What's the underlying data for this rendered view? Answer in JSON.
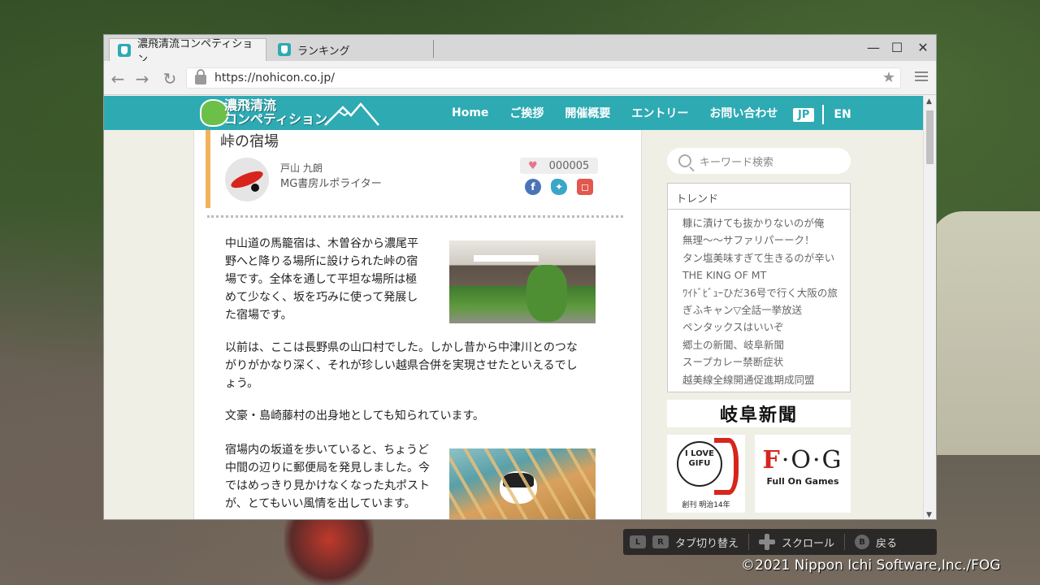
{
  "browser": {
    "tabs": [
      {
        "label": "濃飛清流コンペティション",
        "active": true
      },
      {
        "label": "ランキング",
        "active": false
      }
    ],
    "window_controls": {
      "minimize": "—",
      "maximize": "☐",
      "close": "✕"
    },
    "url": "https://nohicon.co.jp/"
  },
  "site": {
    "logo_line1": "濃飛清流",
    "logo_line2": "コンペティション",
    "nav": [
      "Home",
      "ご挨拶",
      "開催概要",
      "エントリー",
      "お問い合わせ"
    ],
    "lang_jp": "JP",
    "lang_en": "EN"
  },
  "article": {
    "title": "峠の宿場",
    "author_name": "戸山 九朗",
    "author_role": "MG書房ルポライター",
    "likes": "000005",
    "paragraphs": [
      "中山道の馬籠宿は、木曽谷から濃尾平野へと降りる場所に設けられた峠の宿場です。全体を通して平坦な場所は極めて少なく、坂を巧みに使って発展した宿場です。",
      "以前は、ここは長野県の山口村でした。しかし昔から中津川とのつながりがかなり深く、それが珍しい越県合併を実現させたといえるでしょう。",
      "文豪・島崎藤村の出身地としても知られています。",
      "宿場内の坂道を歩いていると、ちょうど中間の辺りに郵便局を発見しました。今ではめっきり見かけなくなった丸ポストが、とてもいい風情を出しています。"
    ]
  },
  "sidebar": {
    "search_placeholder": "キーワード検索",
    "trend_title": "トレンド",
    "trends": [
      "糠に漬けても抜かりないのが俺",
      "無理～～サファリパーーク！",
      "タン塩美味すぎて生きるのが辛い",
      "THE KING OF MT",
      "ﾜｲﾄﾞﾋﾞｭｰひだ36号で行く大阪の旅",
      "ぎふキャン▽全話一挙放送",
      "ペンタックスはいいぞ",
      "郷土の新聞、岐阜新聞",
      "スープカレー禁断症状",
      "越美線全線開通促進期成同盟"
    ],
    "banner": "岐阜新聞",
    "ad1_text": "I LOVE GIFU",
    "ad1_caption": "創刊 明治14年",
    "ad2_logo_f": "F",
    "ad2_logo_rest": "·O·G",
    "ad2_sub": "Full On Games"
  },
  "hints": {
    "l": "L",
    "r": "R",
    "tab_switch": "タブ切り替え",
    "scroll": "スクロール",
    "b": "B",
    "back": "戻る"
  },
  "copyright": "©2021 Nippon Ichi Software,Inc./FOG",
  "colors": {
    "accent": "#2eaab3",
    "title_bar": "#f3b25c",
    "heart": "#e9738a"
  }
}
